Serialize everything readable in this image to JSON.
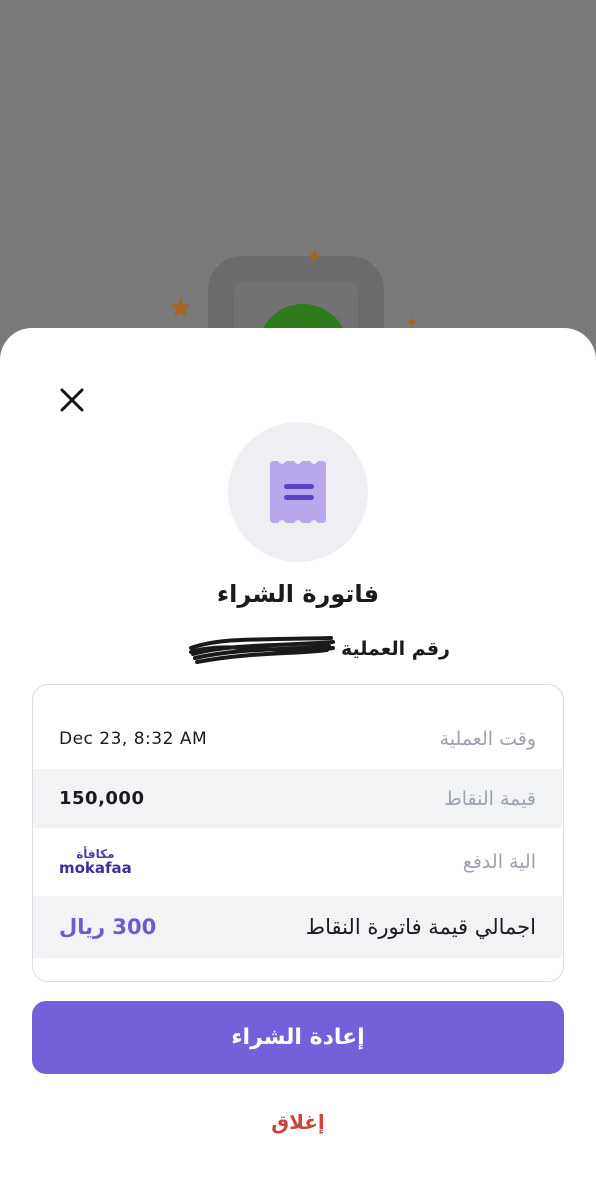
{
  "sheet": {
    "title": "فاتورة الشراء",
    "transaction_number_label": "رقم العملية"
  },
  "details": {
    "time": {
      "label": "وقت العملية",
      "value": "Dec 23, 8:32 AM"
    },
    "points_value": {
      "label": "قيمة النقاط",
      "value": "150,000"
    },
    "payment_method": {
      "label": "الية الدفع",
      "brand_ar": "مكافأة",
      "brand_en": "mokafaa"
    },
    "total": {
      "label": "اجمالي قيمة فاتورة النقاط",
      "value": "300 ريال"
    }
  },
  "actions": {
    "repurchase_label": "إعادة الشراء",
    "close_label": "إغلاق"
  },
  "colors": {
    "accent": "#7460da",
    "brand": "#3d2f9e",
    "danger": "#c9463e"
  },
  "icons": [
    "close-icon",
    "receipt-icon",
    "sparkle-icon"
  ]
}
